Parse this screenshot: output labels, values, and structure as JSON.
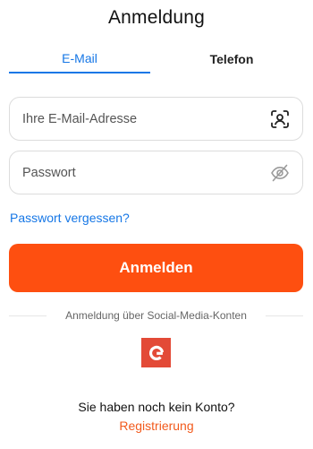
{
  "header": {
    "title": "Anmeldung"
  },
  "tabs": [
    {
      "label": "E-Mail",
      "active": true
    },
    {
      "label": "Telefon",
      "active": false
    }
  ],
  "form": {
    "email_placeholder": "Ihre E-Mail-Adresse",
    "email_value": "",
    "email_icon": "contact-card-icon",
    "password_placeholder": "Passwort",
    "password_value": "",
    "password_icon": "eye-off-icon",
    "forgot_label": "Passwort vergessen?",
    "submit_label": "Anmelden"
  },
  "social": {
    "divider_text": "Anmeldung über Social-Media-Konten",
    "google_letter": "G"
  },
  "footer": {
    "no_account_text": "Sie haben noch kein Konto?",
    "register_label": "Registrierung"
  },
  "colors": {
    "accent_blue": "#1677e6",
    "primary_orange": "#fe4f10",
    "register_orange": "#f25a1c",
    "google_red": "#e34a37"
  }
}
